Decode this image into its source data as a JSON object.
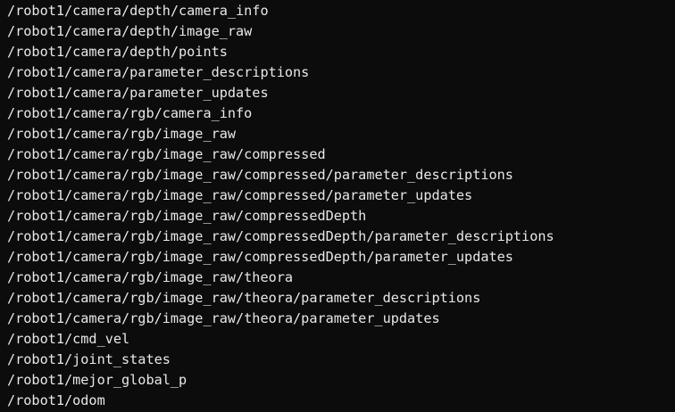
{
  "terminal": {
    "lines": [
      "/robot1/camera/depth/camera_info",
      "/robot1/camera/depth/image_raw",
      "/robot1/camera/depth/points",
      "/robot1/camera/parameter_descriptions",
      "/robot1/camera/parameter_updates",
      "/robot1/camera/rgb/camera_info",
      "/robot1/camera/rgb/image_raw",
      "/robot1/camera/rgb/image_raw/compressed",
      "/robot1/camera/rgb/image_raw/compressed/parameter_descriptions",
      "/robot1/camera/rgb/image_raw/compressed/parameter_updates",
      "/robot1/camera/rgb/image_raw/compressedDepth",
      "/robot1/camera/rgb/image_raw/compressedDepth/parameter_descriptions",
      "/robot1/camera/rgb/image_raw/compressedDepth/parameter_updates",
      "/robot1/camera/rgb/image_raw/theora",
      "/robot1/camera/rgb/image_raw/theora/parameter_descriptions",
      "/robot1/camera/rgb/image_raw/theora/parameter_updates",
      "/robot1/cmd_vel",
      "/robot1/joint_states",
      "/robot1/mejor_global_p",
      "/robot1/odom"
    ],
    "colors": {
      "background": "#0c0c0c",
      "text": "#e8e8e8"
    }
  }
}
